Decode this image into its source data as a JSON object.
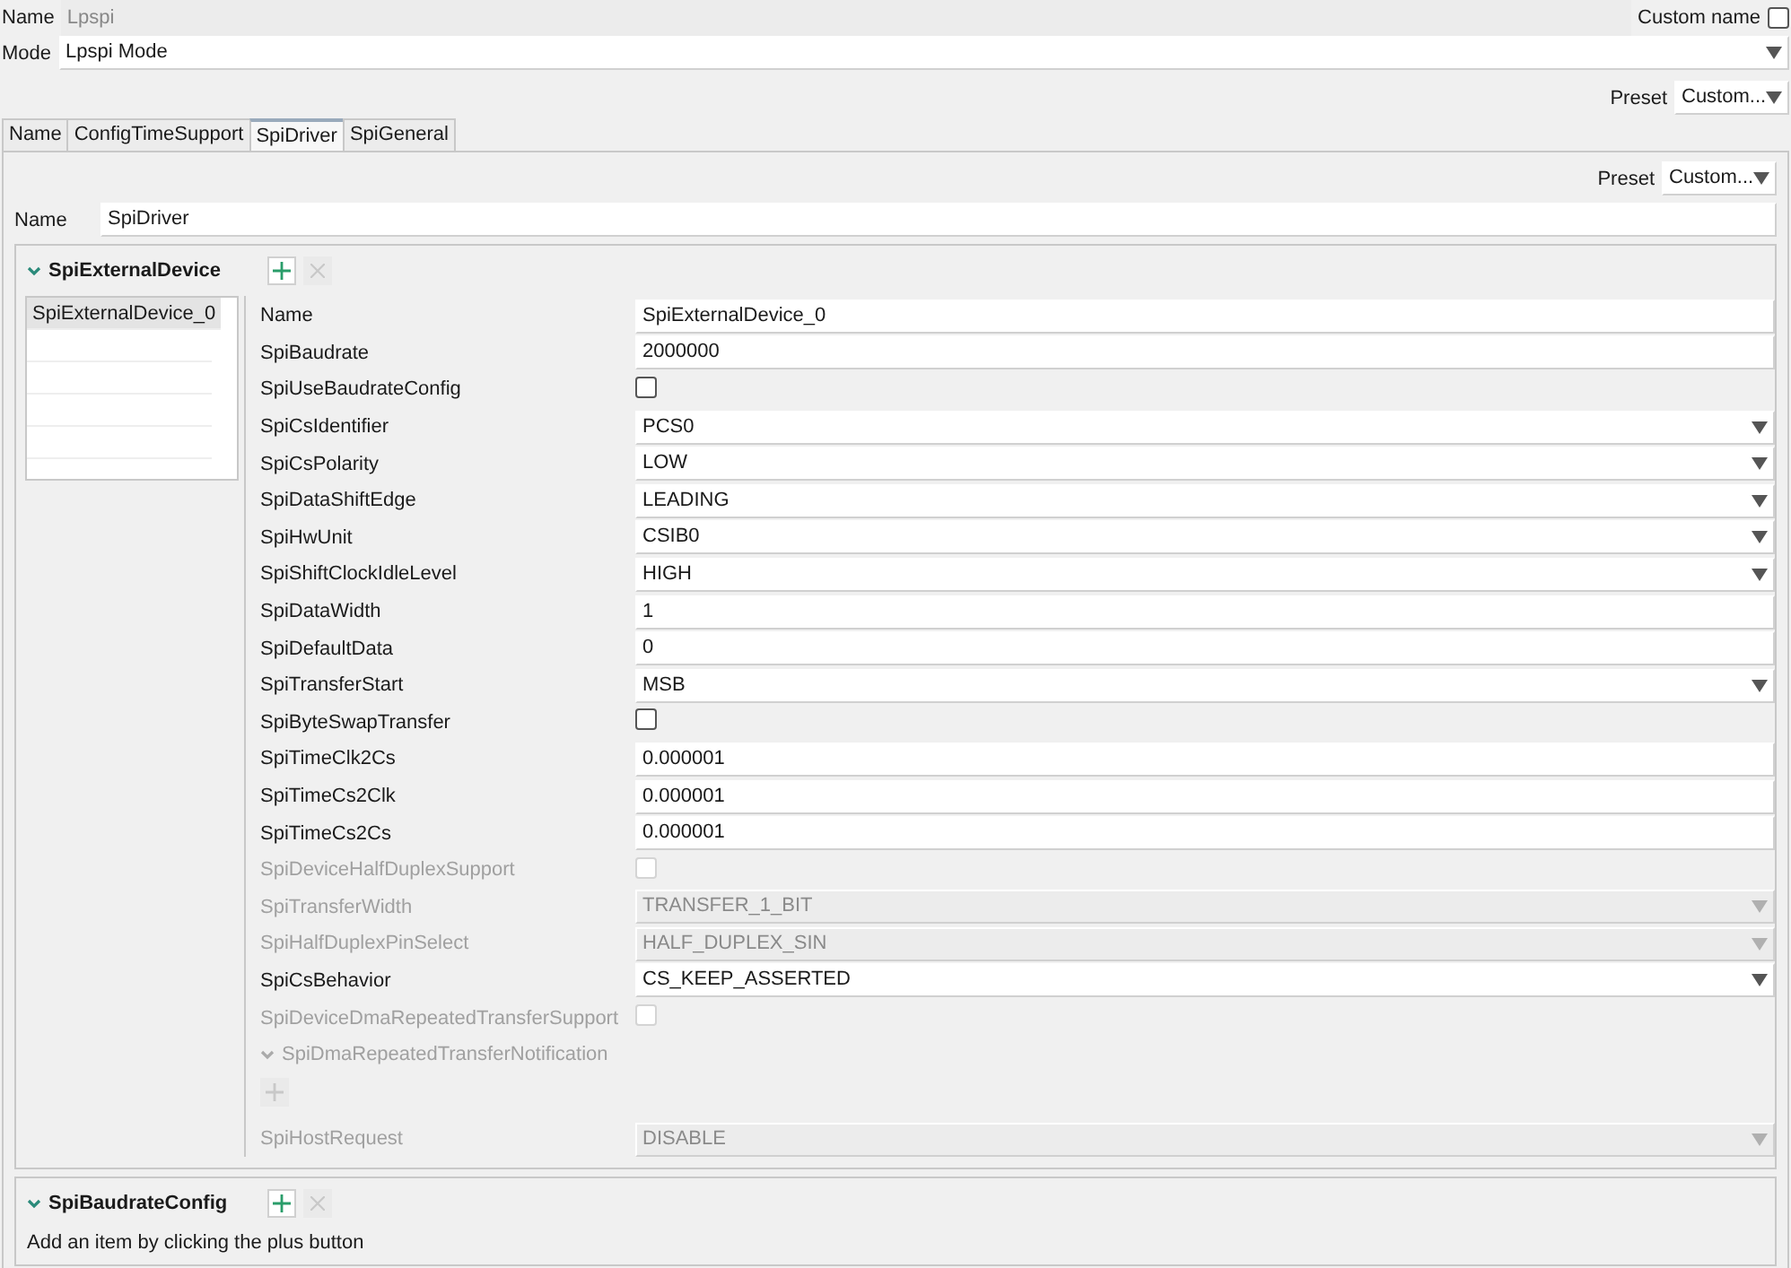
{
  "name": {
    "label": "Name",
    "value": "Lpspi",
    "custom_label": "Custom name",
    "custom_checked": false
  },
  "mode": {
    "label": "Mode",
    "value": "Lpspi Mode"
  },
  "preset": {
    "label": "Preset",
    "value": "Custom..."
  },
  "tabs": [
    {
      "label": "Name",
      "selected": false
    },
    {
      "label": "ConfigTimeSupport",
      "selected": false
    },
    {
      "label": "SpiDriver",
      "selected": true
    },
    {
      "label": "SpiGeneral",
      "selected": false
    }
  ],
  "panel": {
    "preset_label": "Preset",
    "preset_value": "Custom...",
    "name_label": "Name",
    "name_value": "SpiDriver"
  },
  "external_device": {
    "title": "SpiExternalDevice",
    "expanded": true,
    "list": [
      {
        "label": "SpiExternalDevice_0",
        "selected": true
      }
    ],
    "properties": [
      {
        "kind": "text",
        "label": "Name",
        "value": "SpiExternalDevice_0",
        "disabled": false
      },
      {
        "kind": "text",
        "label": "SpiBaudrate",
        "value": "2000000",
        "disabled": false
      },
      {
        "kind": "check",
        "label": "SpiUseBaudrateConfig",
        "checked": false,
        "disabled": false
      },
      {
        "kind": "select",
        "label": "SpiCsIdentifier",
        "value": "PCS0",
        "disabled": false
      },
      {
        "kind": "select",
        "label": "SpiCsPolarity",
        "value": "LOW",
        "disabled": false
      },
      {
        "kind": "select",
        "label": "SpiDataShiftEdge",
        "value": "LEADING",
        "disabled": false
      },
      {
        "kind": "select",
        "label": "SpiHwUnit",
        "value": "CSIB0",
        "disabled": false
      },
      {
        "kind": "select",
        "label": "SpiShiftClockIdleLevel",
        "value": "HIGH",
        "disabled": false
      },
      {
        "kind": "text",
        "label": "SpiDataWidth",
        "value": "1",
        "disabled": false
      },
      {
        "kind": "text",
        "label": "SpiDefaultData",
        "value": "0",
        "disabled": false
      },
      {
        "kind": "select",
        "label": "SpiTransferStart",
        "value": "MSB",
        "disabled": false
      },
      {
        "kind": "check",
        "label": "SpiByteSwapTransfer",
        "checked": false,
        "disabled": false
      },
      {
        "kind": "text",
        "label": "SpiTimeClk2Cs",
        "value": "0.000001",
        "disabled": false
      },
      {
        "kind": "text",
        "label": "SpiTimeCs2Clk",
        "value": "0.000001",
        "disabled": false
      },
      {
        "kind": "text",
        "label": "SpiTimeCs2Cs",
        "value": "0.000001",
        "disabled": false
      },
      {
        "kind": "check",
        "label": "SpiDeviceHalfDuplexSupport",
        "checked": false,
        "disabled": true
      },
      {
        "kind": "select",
        "label": "SpiTransferWidth",
        "value": "TRANSFER_1_BIT",
        "disabled": true
      },
      {
        "kind": "select",
        "label": "SpiHalfDuplexPinSelect",
        "value": "HALF_DUPLEX_SIN",
        "disabled": true
      },
      {
        "kind": "select",
        "label": "SpiCsBehavior",
        "value": "CS_KEEP_ASSERTED",
        "disabled": false
      },
      {
        "kind": "check",
        "label": "SpiDeviceDmaRepeatedTransferSupport",
        "checked": false,
        "disabled": true
      },
      {
        "kind": "group",
        "label": "SpiDmaRepeatedTransferNotification",
        "expanded": true,
        "disabled": true
      },
      {
        "kind": "select",
        "label": "SpiHostRequest",
        "value": "DISABLE",
        "disabled": true
      }
    ]
  },
  "baudrate_config": {
    "title": "SpiBaudrateConfig",
    "expanded": true,
    "hint": "Add an item by clicking the plus button"
  }
}
